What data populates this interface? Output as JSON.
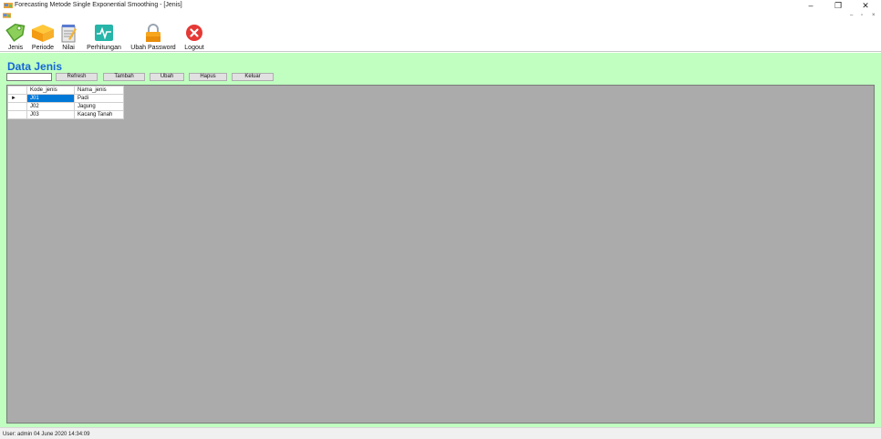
{
  "window": {
    "title": "Forecasting Metode Single Exponential Smoothing - [Jenis]",
    "controls": {
      "minimize": "–",
      "restore": "❐",
      "close": "✕"
    },
    "mdi_controls": {
      "minimize": "–",
      "restore": "▫",
      "close": "×"
    }
  },
  "toolbar": {
    "items": [
      {
        "label": "Jenis",
        "icon": "tag-icon"
      },
      {
        "label": "Periode",
        "icon": "box-icon"
      },
      {
        "label": "Nilai",
        "icon": "notepad-icon"
      },
      {
        "label": "Perhitungan",
        "icon": "pulse-icon"
      },
      {
        "label": "Ubah Password",
        "icon": "lock-icon"
      },
      {
        "label": "Logout",
        "icon": "close-circle-icon"
      }
    ]
  },
  "page": {
    "title": "Data Jenis",
    "search_value": "",
    "buttons": {
      "refresh": "Refresh",
      "tambah": "Tambah",
      "ubah": "Ubah",
      "hapus": "Hapus",
      "keluar": "Keluar"
    }
  },
  "table": {
    "columns": [
      "Kode_jenis",
      "Nama_jenis"
    ],
    "rows": [
      {
        "kode": "J01",
        "nama": "Padi",
        "selected": true
      },
      {
        "kode": "J02",
        "nama": "Jagung",
        "selected": false
      },
      {
        "kode": "J03",
        "nama": "Kacang Tanah",
        "selected": false
      }
    ],
    "current_row_marker": "►"
  },
  "status": {
    "text": "User: admin  04 June 2020 14:34:09"
  },
  "colors": {
    "accent": "#1565d8",
    "main_bg": "#c0ffc0",
    "grid_bg": "#ababab",
    "selection": "#0078d7"
  }
}
